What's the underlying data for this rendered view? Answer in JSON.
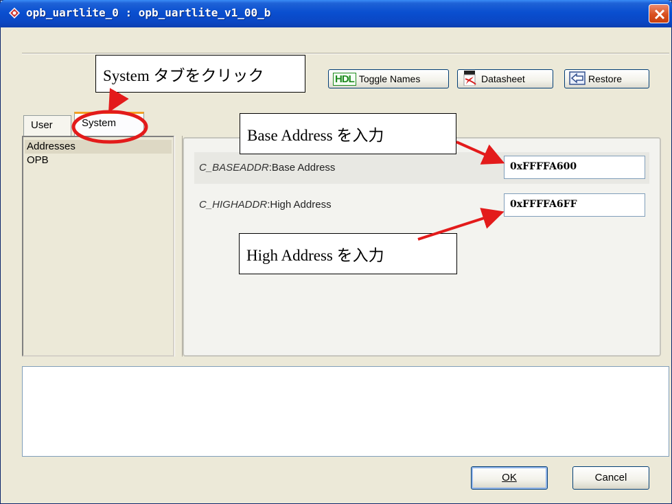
{
  "window": {
    "title": "opb_uartlite_0 : opb_uartlite_v1_00_b"
  },
  "toolbar": {
    "hdl_icon_text": "HDL",
    "toggle_names": "Toggle Names",
    "datasheet": "Datasheet",
    "restore": "Restore"
  },
  "tabs": [
    {
      "label": "User",
      "active": false
    },
    {
      "label": "System",
      "active": true
    }
  ],
  "left_list": {
    "items": [
      "Addresses",
      "OPB"
    ],
    "selected": "Addresses"
  },
  "params": {
    "base": {
      "name": "C_BASEADDR",
      "desc": "Base Address",
      "value": "0xFFFFA600"
    },
    "high": {
      "name": "C_HIGHADDR",
      "desc": "High Address",
      "value": "0xFFFFA6FF"
    }
  },
  "buttons": {
    "ok": "OK",
    "cancel": "Cancel"
  },
  "annotations": {
    "system_tab": "System タブをクリック",
    "base_address": "Base Address を入力",
    "high_address": "High Address を入力"
  },
  "colors": {
    "title_bar": "#0b4fd0",
    "close_button": "#d9501f",
    "tab_highlight": "#f4a022",
    "annotation_red": "#e31b1b"
  },
  "icons": {
    "app": "xilinx-app-icon",
    "close": "close-icon",
    "hdl": "hdl-icon",
    "datasheet": "pdf-icon",
    "restore": "restore-arrow-icon"
  }
}
